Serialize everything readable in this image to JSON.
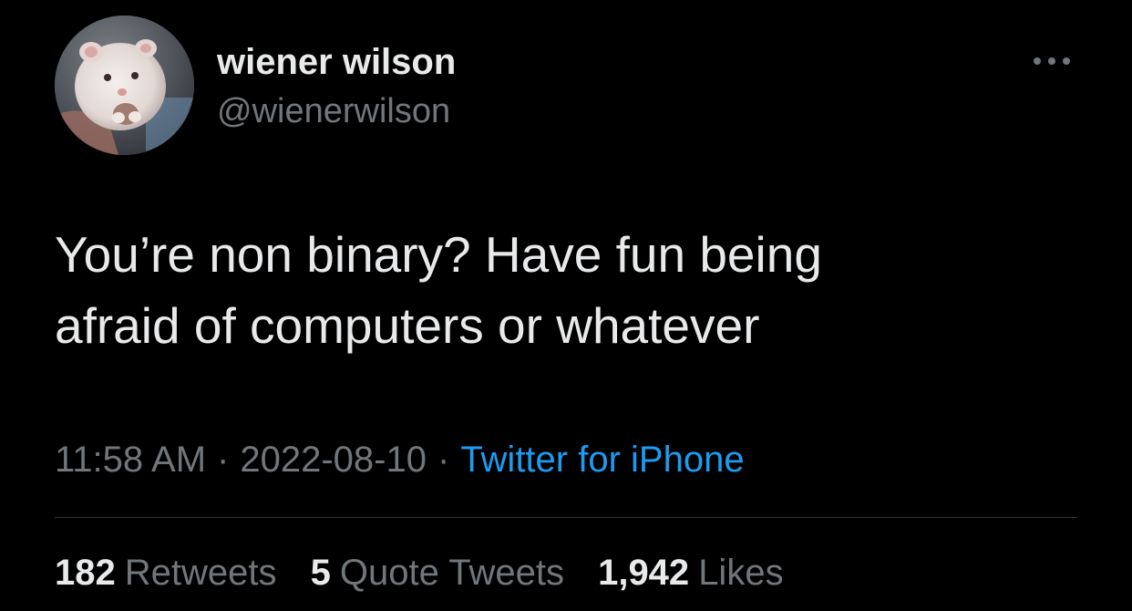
{
  "author": {
    "display_name": "wiener wilson",
    "handle": "@wienerwilson",
    "avatar_icon": "hamster-avatar"
  },
  "tweet": {
    "text": "You’re non binary? Have fun being\nafraid of computers or whatever",
    "time": "11:58 AM",
    "date": "2022-08-10",
    "separator": "·",
    "source": "Twitter for iPhone"
  },
  "stats": {
    "retweets_count": "182",
    "retweets_label": "Retweets",
    "quotes_count": "5",
    "quotes_label": "Quote Tweets",
    "likes_count": "1,942",
    "likes_label": "Likes"
  },
  "more_icon": "more-horizontal-icon",
  "colors": {
    "background": "#000000",
    "primary_text": "#e7e9ea",
    "secondary_text": "#71767b",
    "link": "#1d9bf0",
    "divider": "#2f3336"
  }
}
